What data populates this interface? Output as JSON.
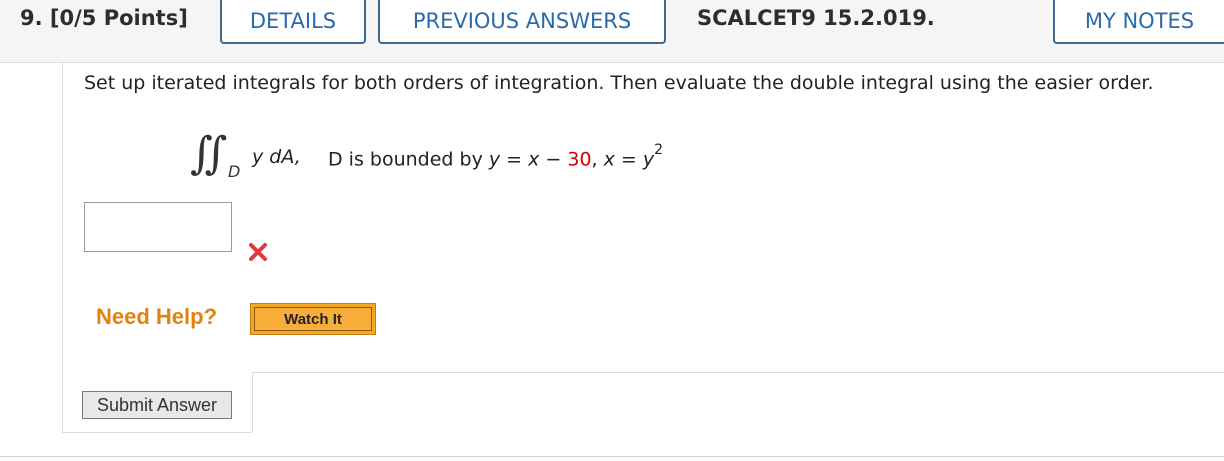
{
  "header": {
    "question_label": "9. [0/5 Points]",
    "details_tab": "DETAILS",
    "previous_answers_tab": "PREVIOUS ANSWERS",
    "assignment_id": "SCALCET9 15.2.019.",
    "my_notes_tab": "MY NOTES"
  },
  "problem": {
    "prompt": "Set up iterated integrals for both orders of integration. Then evaluate the double integral using the easier order.",
    "integral_sign": "∬",
    "integral_region": "D",
    "integrand_var": "y",
    "integrand_diff": " dA,",
    "bounds_prefix": "D is bounded by ",
    "bounds_y": "y",
    "bounds_eq1": " = ",
    "bounds_x1": "x",
    "bounds_minus": " − ",
    "bounds_const": "30",
    "bounds_sep": ", ",
    "bounds_x2": "x",
    "bounds_eq2": " = ",
    "bounds_y2": "y",
    "bounds_exp": "2"
  },
  "answer": {
    "value": "",
    "status_icon": "red-x-icon",
    "status_color": "#e0393e"
  },
  "help": {
    "need_help_label": "Need Help?",
    "watch_button": "Watch It",
    "need_help_color": "#e3820f"
  },
  "submit_button": "Submit Answer",
  "colors": {
    "tab_border": "#3e6a92",
    "tab_text": "#2b6aa8",
    "highlight_number": "#d60000"
  }
}
